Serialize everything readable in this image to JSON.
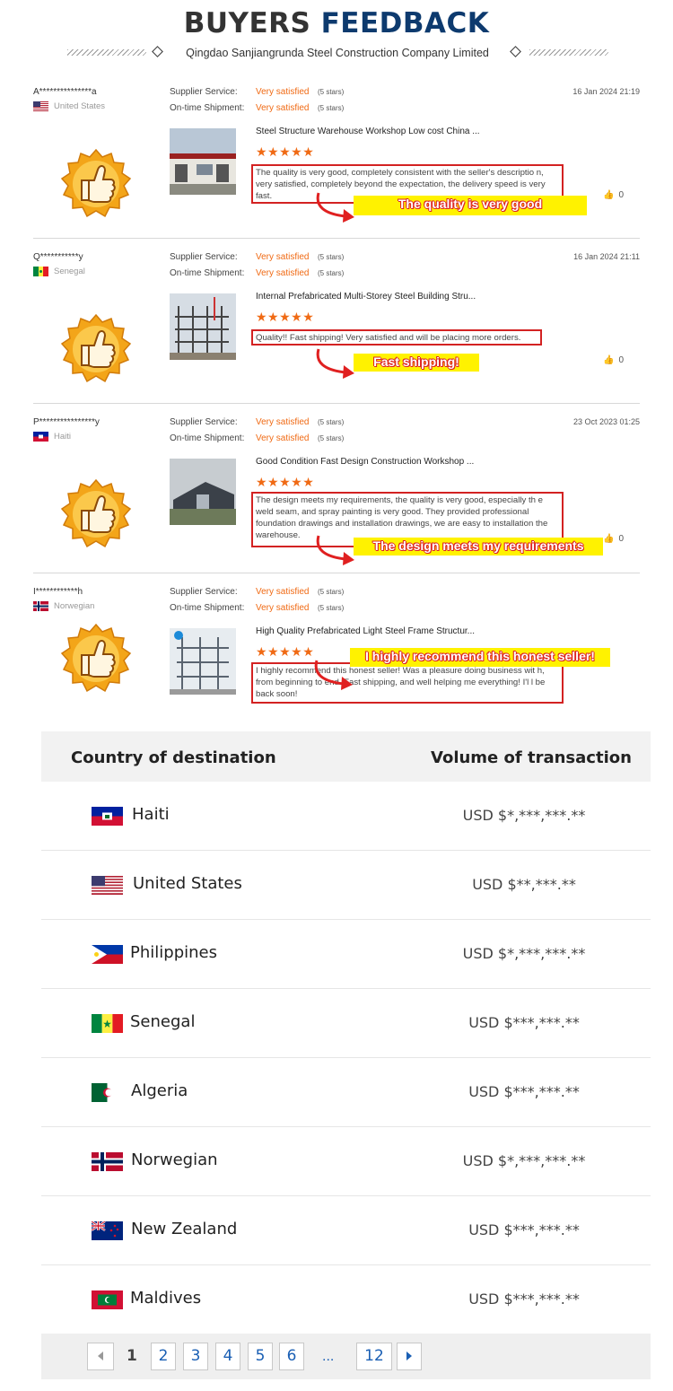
{
  "header": {
    "title_part1": "BUYERS",
    "title_part2": "FEEDBACK",
    "company": "Qingdao Sanjiangrunda Steel Construction Company Limited"
  },
  "rating_labels": {
    "supplier_service": "Supplier Service:",
    "on_time_shipment": "On-time Shipment:"
  },
  "reviews": [
    {
      "buyer": "A***************a",
      "country": "United States",
      "supplier_service": "Very satisfied",
      "supplier_stars": "(5 stars)",
      "shipment": "Very satisfied",
      "shipment_stars": "(5 stars)",
      "date": "16 Jan 2024 21:19",
      "product": "Steel Structure Warehouse Workshop Low cost China ...",
      "stars": "★★★★★",
      "comment": "The quality is very good, completely consistent with the seller's descriptio n, very satisfied,  completely beyond the expectation, the delivery speed is very fast.",
      "callout": "The quality is very good",
      "likes": "0"
    },
    {
      "buyer": "Q***********y",
      "country": "Senegal",
      "supplier_service": "Very satisfied",
      "supplier_stars": "(5 stars)",
      "shipment": "Very satisfied",
      "shipment_stars": "(5 stars)",
      "date": "16 Jan 2024 21:11",
      "product": "Internal Prefabricated Multi-Storey Steel Building Stru...",
      "stars": "★★★★★",
      "comment": "Quality!! Fast shipping! Very satisfied and will be placing more orders.",
      "callout": "Fast shipping!",
      "likes": "0"
    },
    {
      "buyer": "P****************y",
      "country": "Haiti",
      "supplier_service": "Very satisfied",
      "supplier_stars": "(5 stars)",
      "shipment": "Very satisfied",
      "shipment_stars": "(5 stars)",
      "date": "23 Oct 2023 01:25",
      "product": "Good Condition Fast Design Construction Workshop ...",
      "stars": "★★★★★",
      "comment": "The design meets my requirements, the quality is very good, especially th e weld seam, and spray painting is very good. They provided professional foundation drawings and installation drawings, we are easy to installation the warehouse.",
      "callout": "The design meets my requirements",
      "likes": "0"
    },
    {
      "buyer": "I************h",
      "country": "Norwegian",
      "supplier_service": "Very satisfied",
      "supplier_stars": "(5 stars)",
      "shipment": "Very satisfied",
      "shipment_stars": "(5 stars)",
      "date": "",
      "product": "High Quality Prefabricated Light Steel Frame Structur...",
      "stars": "★★★★★",
      "comment": "I highly recommend this honest seller! Was a pleasure doing business wit h, from beginning to end. Fast shipping, and well helping me everything! I'l l be back soon!",
      "callout": "I highly recommend this honest seller!",
      "likes": ""
    }
  ],
  "table": {
    "col1": "Country of destination",
    "col2": "Volume of transaction",
    "rows": [
      {
        "country": "Haiti",
        "volume": "USD $*,***,***.**",
        "flag": "haiti-flag-icon"
      },
      {
        "country": "United States",
        "volume": "USD $**,***.**",
        "flag": "us-flag-icon"
      },
      {
        "country": "Philippines",
        "volume": "USD $*,***,***.**",
        "flag": "philippines-flag-icon"
      },
      {
        "country": "Senegal",
        "volume": "USD $***,***.**",
        "flag": "senegal-flag-icon"
      },
      {
        "country": "Algeria",
        "volume": "USD $***,***.**",
        "flag": "algeria-flag-icon"
      },
      {
        "country": "Norwegian",
        "volume": "USD $*,***,***.**",
        "flag": "norway-flag-icon"
      },
      {
        "country": "New Zealand",
        "volume": "USD $***,***.**",
        "flag": "new-zealand-flag-icon"
      },
      {
        "country": "Maldives",
        "volume": "USD $***,***.**",
        "flag": "maldives-flag-icon"
      }
    ]
  },
  "pagination": {
    "current": "1",
    "pages": [
      "2",
      "3",
      "4",
      "5",
      "6"
    ],
    "ellipsis": "...",
    "last": "12"
  },
  "colors": {
    "title_accent": "#0d3a6e",
    "satisfied": "#f06a14",
    "highlight_border": "#d32222",
    "callout_bg": "#fff200",
    "link": "#1a5fb4"
  }
}
